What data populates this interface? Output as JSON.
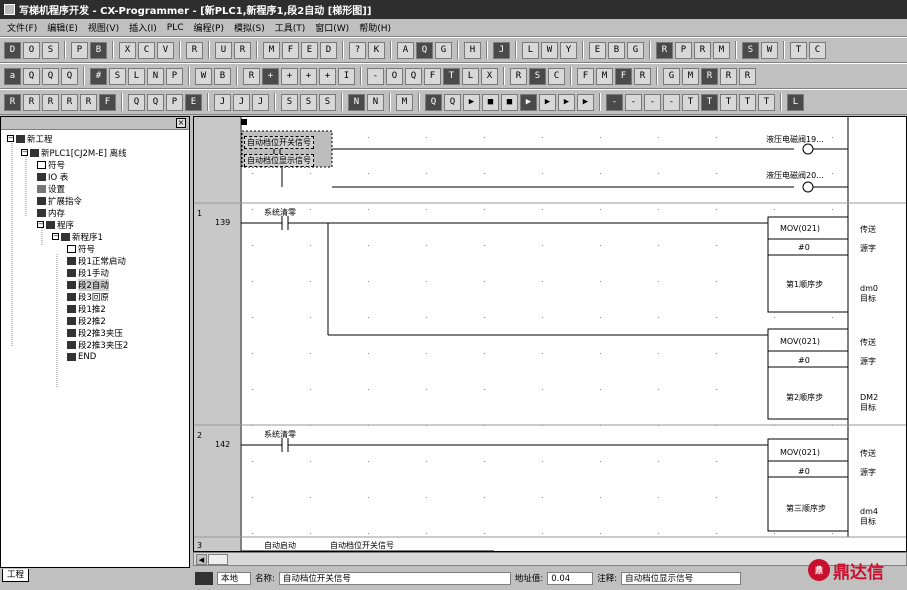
{
  "window": {
    "title": "写梯机程序开发 - CX-Programmer - [新PLC1,新程序1,段2自动 [梯形图]]"
  },
  "menu": [
    "文件(F)",
    "编辑(E)",
    "视图(V)",
    "插入(I)",
    "PLC",
    "编程(P)",
    "模拟(S)",
    "工具(T)",
    "窗口(W)",
    "帮助(H)"
  ],
  "toolbars": {
    "row1": [
      "D",
      "O",
      "S",
      "|",
      "P",
      "B",
      "|",
      "X",
      "C",
      "V",
      "|",
      "R",
      "|",
      "U",
      "R",
      "|",
      "M",
      "F",
      "E",
      "D",
      "|",
      "?",
      "K",
      "|",
      "A",
      "Q",
      "G",
      "|",
      "H",
      "|",
      "J",
      "|",
      "L",
      "W",
      "Y",
      "|",
      "E",
      "B",
      "G",
      "|",
      "R",
      "P",
      "R",
      "M",
      "|",
      "S",
      "W",
      "|",
      "T",
      "C"
    ],
    "row2": [
      "a",
      "Q",
      "Q",
      "Q",
      "|",
      "#",
      "S",
      "L",
      "N",
      "P",
      "|",
      "W",
      "B",
      "|",
      "R",
      "+",
      "+",
      "+",
      "+",
      "I",
      "|",
      "-",
      "O",
      "Q",
      "F",
      "T",
      "L",
      "X",
      "|",
      "R",
      "S",
      "C",
      "|",
      "F",
      "M",
      "F",
      "R",
      "|",
      "G",
      "M",
      "R",
      "R",
      "R"
    ],
    "row3": [
      "R",
      "R",
      "R",
      "R",
      "R",
      "F",
      "|",
      "Q",
      "Q",
      "P",
      "E",
      "|",
      "J",
      "J",
      "J",
      "|",
      "S",
      "S",
      "S",
      "|",
      "N",
      "N",
      "|",
      "M",
      "|",
      "Q",
      "Q",
      "▶",
      "■",
      "■",
      "▶",
      "▶",
      "▶",
      "▶",
      "|",
      "-",
      "-",
      "-",
      "-",
      "T",
      "T",
      "T",
      "T",
      "T",
      "|",
      "L"
    ]
  },
  "tree": {
    "items": [
      {
        "label": "新工程"
      },
      {
        "label": "新PLC1[CJ2M-E] 离线"
      },
      {
        "label": "符号"
      },
      {
        "label": "IO 表"
      },
      {
        "label": "设置"
      },
      {
        "label": "扩展指令"
      },
      {
        "label": "内存"
      },
      {
        "label": "程序"
      },
      {
        "label": "新程序1"
      },
      {
        "label": "符号"
      },
      {
        "label": "段1正常启动"
      },
      {
        "label": "段1手动"
      },
      {
        "label": "段2自动"
      },
      {
        "label": "段3回原"
      },
      {
        "label": "段1推2"
      },
      {
        "label": "段2推2"
      },
      {
        "label": "段2推3夹压"
      },
      {
        "label": "段2推3夹压2"
      },
      {
        "label": "END"
      }
    ],
    "tab_label": "工程"
  },
  "ladder": {
    "top_rung": {
      "contact_a": "自动档位开关信号",
      "contact_b": "自动档位显示信号",
      "coil_a": "液压电磁阀19...",
      "coil_b": "液压电磁阀20..."
    },
    "rungs": [
      {
        "index": "1",
        "step": "139",
        "contact": "系统清零",
        "blocks": [
          {
            "instr": "MOV(021)",
            "operand1": "#0",
            "operand2": "第1顺序步",
            "side1": "传送",
            "side2": "源字",
            "side3": "dm0",
            "side4": "目标"
          },
          {
            "instr": "MOV(021)",
            "operand1": "#0",
            "operand2": "第2顺序步",
            "side1": "传送",
            "side2": "源字",
            "side3": "DM2",
            "side4": "目标"
          }
        ]
      },
      {
        "index": "2",
        "step": "142",
        "contact": "系统清零",
        "blocks": [
          {
            "instr": "MOV(021)",
            "operand1": "#0",
            "operand2": "第三顺序步",
            "side1": "传送",
            "side2": "源字",
            "side3": "dm4",
            "side4": "目标"
          }
        ]
      },
      {
        "index": "3",
        "contact": "自动启动",
        "contact2": "自动档位开关信号"
      }
    ]
  },
  "status": {
    "local_label": "本地",
    "name_label": "名称:",
    "name_value": "自动档位开关信号",
    "addr_label": "地址值:",
    "addr_value": "0.04",
    "comment_label": "注释:",
    "comment_value": "自动档位显示信号"
  },
  "brand": {
    "logo_text": "鼎",
    "name": "鼎达信"
  }
}
